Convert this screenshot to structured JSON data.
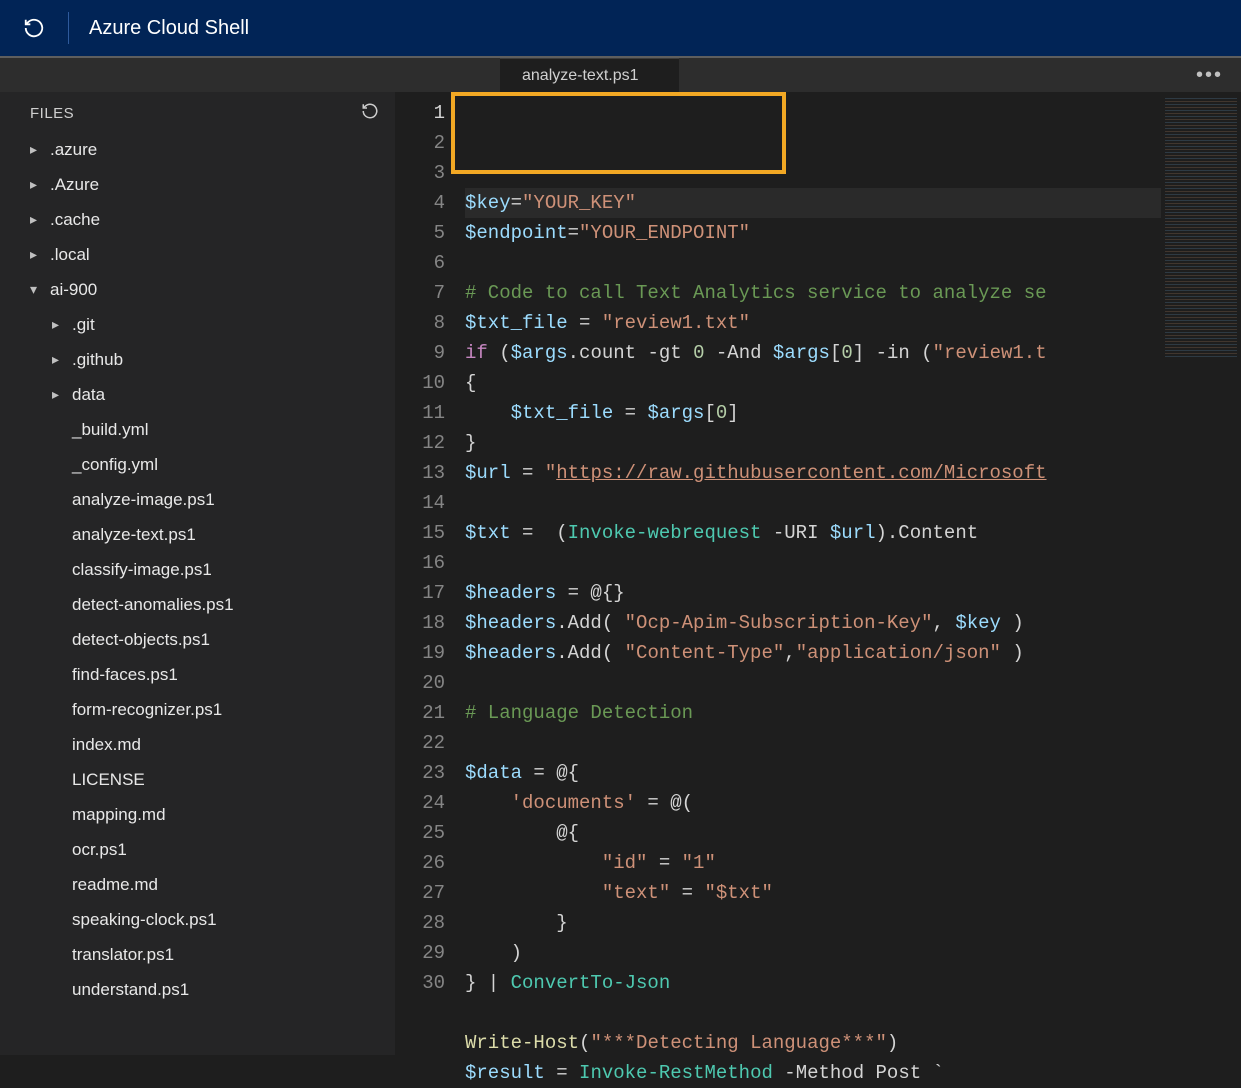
{
  "header": {
    "title": "Azure Cloud Shell"
  },
  "tab": {
    "label": "analyze-text.ps1"
  },
  "sidebar": {
    "header": "FILES",
    "tree": [
      {
        "label": ".azure",
        "depth": 0,
        "chev": "right"
      },
      {
        "label": ".Azure",
        "depth": 0,
        "chev": "right"
      },
      {
        "label": ".cache",
        "depth": 0,
        "chev": "right"
      },
      {
        "label": ".local",
        "depth": 0,
        "chev": "right"
      },
      {
        "label": "ai-900",
        "depth": 0,
        "chev": "down"
      },
      {
        "label": ".git",
        "depth": 1,
        "chev": "right"
      },
      {
        "label": ".github",
        "depth": 1,
        "chev": "right"
      },
      {
        "label": "data",
        "depth": 1,
        "chev": "right"
      },
      {
        "label": "_build.yml",
        "depth": 1,
        "chev": "none"
      },
      {
        "label": "_config.yml",
        "depth": 1,
        "chev": "none"
      },
      {
        "label": "analyze-image.ps1",
        "depth": 1,
        "chev": "none"
      },
      {
        "label": "analyze-text.ps1",
        "depth": 1,
        "chev": "none"
      },
      {
        "label": "classify-image.ps1",
        "depth": 1,
        "chev": "none"
      },
      {
        "label": "detect-anomalies.ps1",
        "depth": 1,
        "chev": "none"
      },
      {
        "label": "detect-objects.ps1",
        "depth": 1,
        "chev": "none"
      },
      {
        "label": "find-faces.ps1",
        "depth": 1,
        "chev": "none"
      },
      {
        "label": "form-recognizer.ps1",
        "depth": 1,
        "chev": "none"
      },
      {
        "label": "index.md",
        "depth": 1,
        "chev": "none"
      },
      {
        "label": "LICENSE",
        "depth": 1,
        "chev": "none"
      },
      {
        "label": "mapping.md",
        "depth": 1,
        "chev": "none"
      },
      {
        "label": "ocr.ps1",
        "depth": 1,
        "chev": "none"
      },
      {
        "label": "readme.md",
        "depth": 1,
        "chev": "none"
      },
      {
        "label": "speaking-clock.ps1",
        "depth": 1,
        "chev": "none"
      },
      {
        "label": "translator.ps1",
        "depth": 1,
        "chev": "none"
      },
      {
        "label": "understand.ps1",
        "depth": 1,
        "chev": "none"
      }
    ]
  },
  "editor": {
    "activeLine": 1,
    "lines": [
      [
        {
          "t": "$key",
          "c": "tok-var"
        },
        {
          "t": "=",
          "c": "tok-op"
        },
        {
          "t": "\"YOUR_KEY\"",
          "c": "tok-str"
        }
      ],
      [
        {
          "t": "$endpoint",
          "c": "tok-var"
        },
        {
          "t": "=",
          "c": "tok-op"
        },
        {
          "t": "\"YOUR_ENDPOINT\"",
          "c": "tok-str"
        }
      ],
      [],
      [
        {
          "t": "# Code to call Text Analytics service to analyze se",
          "c": "tok-cmt"
        }
      ],
      [
        {
          "t": "$txt_file",
          "c": "tok-var"
        },
        {
          "t": " = ",
          "c": "tok-op"
        },
        {
          "t": "\"review1.txt\"",
          "c": "tok-str"
        }
      ],
      [
        {
          "t": "if",
          "c": "tok-kw"
        },
        {
          "t": " (",
          "c": "tok-punc"
        },
        {
          "t": "$args",
          "c": "tok-var"
        },
        {
          "t": ".count ",
          "c": "tok-op"
        },
        {
          "t": "-gt",
          "c": "tok-op"
        },
        {
          "t": " ",
          "c": "tok-op"
        },
        {
          "t": "0",
          "c": "tok-num"
        },
        {
          "t": " ",
          "c": "tok-op"
        },
        {
          "t": "-And",
          "c": "tok-op"
        },
        {
          "t": " ",
          "c": "tok-op"
        },
        {
          "t": "$args",
          "c": "tok-var"
        },
        {
          "t": "[",
          "c": "tok-punc"
        },
        {
          "t": "0",
          "c": "tok-num"
        },
        {
          "t": "] ",
          "c": "tok-punc"
        },
        {
          "t": "-in",
          "c": "tok-op"
        },
        {
          "t": " (",
          "c": "tok-punc"
        },
        {
          "t": "\"review1.t",
          "c": "tok-str"
        }
      ],
      [
        {
          "t": "{",
          "c": "tok-punc"
        }
      ],
      [
        {
          "t": "    ",
          "c": "tok-op"
        },
        {
          "t": "$txt_file",
          "c": "tok-var"
        },
        {
          "t": " = ",
          "c": "tok-op"
        },
        {
          "t": "$args",
          "c": "tok-var"
        },
        {
          "t": "[",
          "c": "tok-punc"
        },
        {
          "t": "0",
          "c": "tok-num"
        },
        {
          "t": "]",
          "c": "tok-punc"
        }
      ],
      [
        {
          "t": "}",
          "c": "tok-punc"
        }
      ],
      [
        {
          "t": "$url",
          "c": "tok-var"
        },
        {
          "t": " = ",
          "c": "tok-op"
        },
        {
          "t": "\"",
          "c": "tok-str"
        },
        {
          "t": "https://raw.githubusercontent.com/Microsoft",
          "c": "tok-url"
        }
      ],
      [],
      [
        {
          "t": "$txt",
          "c": "tok-var"
        },
        {
          "t": " =  (",
          "c": "tok-op"
        },
        {
          "t": "Invoke-webrequest",
          "c": "tok-cmd"
        },
        {
          "t": " ",
          "c": "tok-op"
        },
        {
          "t": "-URI",
          "c": "tok-op"
        },
        {
          "t": " ",
          "c": "tok-op"
        },
        {
          "t": "$url",
          "c": "tok-var"
        },
        {
          "t": ").Content",
          "c": "tok-op"
        }
      ],
      [],
      [
        {
          "t": "$headers",
          "c": "tok-var"
        },
        {
          "t": " = @{}",
          "c": "tok-op"
        }
      ],
      [
        {
          "t": "$headers",
          "c": "tok-var"
        },
        {
          "t": ".Add( ",
          "c": "tok-op"
        },
        {
          "t": "\"Ocp-Apim-Subscription-Key\"",
          "c": "tok-str"
        },
        {
          "t": ", ",
          "c": "tok-op"
        },
        {
          "t": "$key",
          "c": "tok-var"
        },
        {
          "t": " )",
          "c": "tok-op"
        }
      ],
      [
        {
          "t": "$headers",
          "c": "tok-var"
        },
        {
          "t": ".Add( ",
          "c": "tok-op"
        },
        {
          "t": "\"Content-Type\"",
          "c": "tok-str"
        },
        {
          "t": ",",
          "c": "tok-op"
        },
        {
          "t": "\"application/json\"",
          "c": "tok-str"
        },
        {
          "t": " )",
          "c": "tok-op"
        }
      ],
      [],
      [
        {
          "t": "# Language Detection",
          "c": "tok-cmt"
        }
      ],
      [],
      [
        {
          "t": "$data",
          "c": "tok-var"
        },
        {
          "t": " = @{",
          "c": "tok-op"
        }
      ],
      [
        {
          "t": "    ",
          "c": "tok-op"
        },
        {
          "t": "'documents'",
          "c": "tok-str"
        },
        {
          "t": " = @(",
          "c": "tok-op"
        }
      ],
      [
        {
          "t": "        @{",
          "c": "tok-op"
        }
      ],
      [
        {
          "t": "            ",
          "c": "tok-op"
        },
        {
          "t": "\"id\"",
          "c": "tok-str"
        },
        {
          "t": " = ",
          "c": "tok-op"
        },
        {
          "t": "\"1\"",
          "c": "tok-str"
        }
      ],
      [
        {
          "t": "            ",
          "c": "tok-op"
        },
        {
          "t": "\"text\"",
          "c": "tok-str"
        },
        {
          "t": " = ",
          "c": "tok-op"
        },
        {
          "t": "\"$txt\"",
          "c": "tok-str"
        }
      ],
      [
        {
          "t": "        }",
          "c": "tok-op"
        }
      ],
      [
        {
          "t": "    )",
          "c": "tok-op"
        }
      ],
      [
        {
          "t": "} | ",
          "c": "tok-op"
        },
        {
          "t": "ConvertTo-Json",
          "c": "tok-cmd"
        }
      ],
      [],
      [
        {
          "t": "Write-Host",
          "c": "tok-func"
        },
        {
          "t": "(",
          "c": "tok-punc"
        },
        {
          "t": "\"***Detecting Language***\"",
          "c": "tok-str"
        },
        {
          "t": ")",
          "c": "tok-punc"
        }
      ],
      [
        {
          "t": "$result",
          "c": "tok-var"
        },
        {
          "t": " = ",
          "c": "tok-op"
        },
        {
          "t": "Invoke-RestMethod",
          "c": "tok-cmd"
        },
        {
          "t": " ",
          "c": "tok-op"
        },
        {
          "t": "-Method",
          "c": "tok-op"
        },
        {
          "t": " Post `",
          "c": "tok-op"
        }
      ]
    ]
  }
}
